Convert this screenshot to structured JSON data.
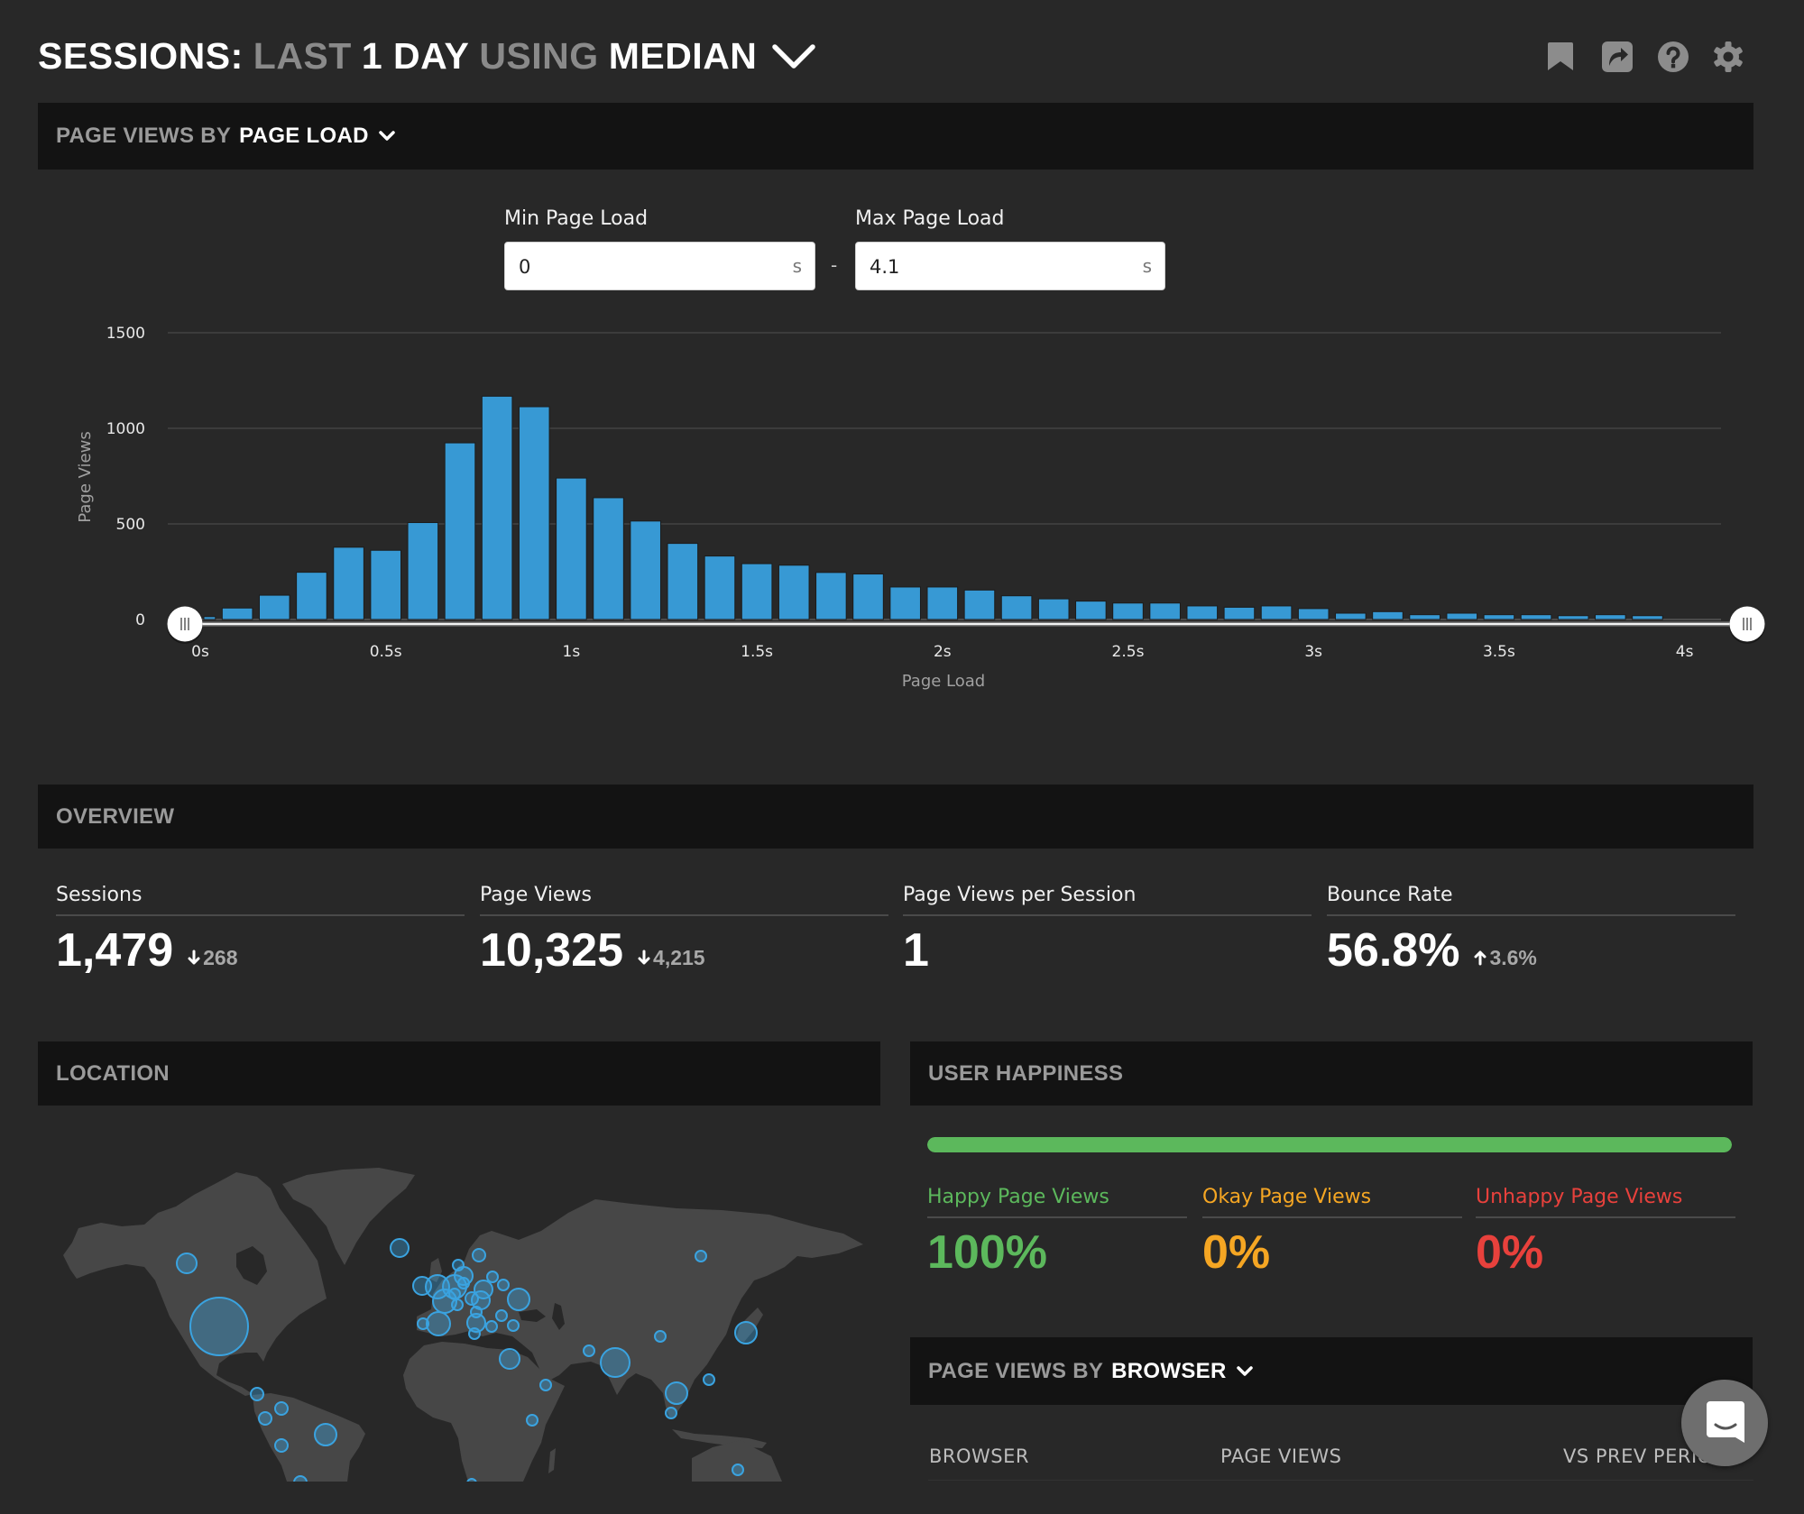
{
  "header": {
    "title_parts": [
      {
        "text": "SESSIONS:",
        "tone": "strong"
      },
      {
        "text": "LAST",
        "tone": "muted"
      },
      {
        "text": "1 DAY",
        "tone": "strong"
      },
      {
        "text": "USING",
        "tone": "muted"
      },
      {
        "text": "MEDIAN",
        "tone": "strong"
      }
    ],
    "toolbar": [
      {
        "name": "bookmark-icon",
        "label": "Bookmark"
      },
      {
        "name": "share-icon",
        "label": "Share"
      },
      {
        "name": "help-icon",
        "label": "Help"
      },
      {
        "name": "gear-icon",
        "label": "Settings"
      }
    ]
  },
  "page_load_panel": {
    "prefix": "PAGE VIEWS BY",
    "dimension": "PAGE LOAD",
    "min_label": "Min Page Load",
    "min_value": "0",
    "max_label": "Max Page Load",
    "max_value": "4.1",
    "unit": "s",
    "separator": "-"
  },
  "chart_data": {
    "type": "bar",
    "title": "Page Views by Page Load",
    "xlabel": "Page Load",
    "ylabel": "Page Views",
    "x_unit": "s",
    "bin_width": 0.1,
    "x": [
      0.0,
      0.1,
      0.2,
      0.3,
      0.4,
      0.5,
      0.6,
      0.7,
      0.8,
      0.9,
      1.0,
      1.1,
      1.2,
      1.3,
      1.4,
      1.5,
      1.6,
      1.7,
      1.8,
      1.9,
      2.0,
      2.1,
      2.2,
      2.3,
      2.4,
      2.5,
      2.6,
      2.7,
      2.8,
      2.9,
      3.0,
      3.1,
      3.2,
      3.3,
      3.4,
      3.5,
      3.6,
      3.7,
      3.8,
      3.9
    ],
    "values": [
      15,
      60,
      127,
      247,
      378,
      362,
      507,
      924,
      1168,
      1113,
      740,
      637,
      515,
      398,
      332,
      292,
      284,
      246,
      238,
      170,
      170,
      154,
      124,
      108,
      96,
      86,
      86,
      71,
      64,
      71,
      57,
      33,
      41,
      25,
      33,
      25,
      25,
      20,
      25,
      20
    ],
    "x_ticks": [
      {
        "value": 0,
        "label": "0s"
      },
      {
        "value": 0.5,
        "label": "0.5s"
      },
      {
        "value": 1,
        "label": "1s"
      },
      {
        "value": 1.5,
        "label": "1.5s"
      },
      {
        "value": 2,
        "label": "2s"
      },
      {
        "value": 2.5,
        "label": "2.5s"
      },
      {
        "value": 3,
        "label": "3s"
      },
      {
        "value": 3.5,
        "label": "3.5s"
      },
      {
        "value": 4,
        "label": "4s"
      }
    ],
    "y_ticks": [
      0,
      500,
      1000,
      1500
    ],
    "ylim": [
      0,
      1500
    ],
    "xlim": [
      0,
      4.1
    ],
    "grid": true,
    "range_selection": [
      0,
      4.1
    ],
    "bar_color": "#3799d4"
  },
  "overview": {
    "title": "OVERVIEW",
    "metrics": [
      {
        "label": "Sessions",
        "value": "1,479",
        "delta": "268",
        "direction": "down"
      },
      {
        "label": "Page Views",
        "value": "10,325",
        "delta": "4,215",
        "direction": "down"
      },
      {
        "label": "Page Views per Session",
        "value": "1",
        "delta": null,
        "direction": null
      },
      {
        "label": "Bounce Rate",
        "value": "56.8%",
        "delta": "3.6%",
        "direction": "up"
      }
    ]
  },
  "location": {
    "title": "LOCATION",
    "land_color": "#474747",
    "bubble_color": "#3aa3e0"
  },
  "user_happiness": {
    "title": "USER HAPPINESS",
    "happy_fraction": 1.0,
    "items": [
      {
        "label": "Happy Page Views",
        "value": "100%",
        "color": "#5cb85c"
      },
      {
        "label": "Okay Page Views",
        "value": "0%",
        "color": "#f5a623"
      },
      {
        "label": "Unhappy Page Views",
        "value": "0%",
        "color": "#e8413c"
      }
    ]
  },
  "browser_panel": {
    "prefix": "PAGE VIEWS BY",
    "dimension": "BROWSER",
    "columns": [
      "BROWSER",
      "PAGE VIEWS",
      "VS PREV PERIOD"
    ]
  },
  "chat": {
    "label": "Open chat"
  }
}
